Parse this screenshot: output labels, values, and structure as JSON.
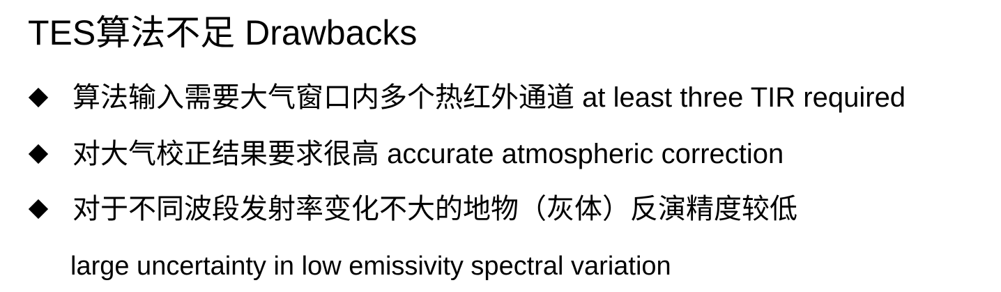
{
  "slide": {
    "title": "TES算法不足 Drawbacks",
    "bullets": [
      {
        "icon": "diamond-bullet-icon",
        "text": "算法输入需要大气窗口内多个热红外通道 at least three TIR required"
      },
      {
        "icon": "diamond-bullet-icon",
        "text": "对大气校正结果要求很高 accurate atmospheric correction"
      },
      {
        "icon": "diamond-bullet-icon",
        "text": "对于不同波段发射率变化不大的地物（灰体）反演精度较低"
      }
    ],
    "continuation": "large uncertainty in low emissivity spectral variation"
  }
}
